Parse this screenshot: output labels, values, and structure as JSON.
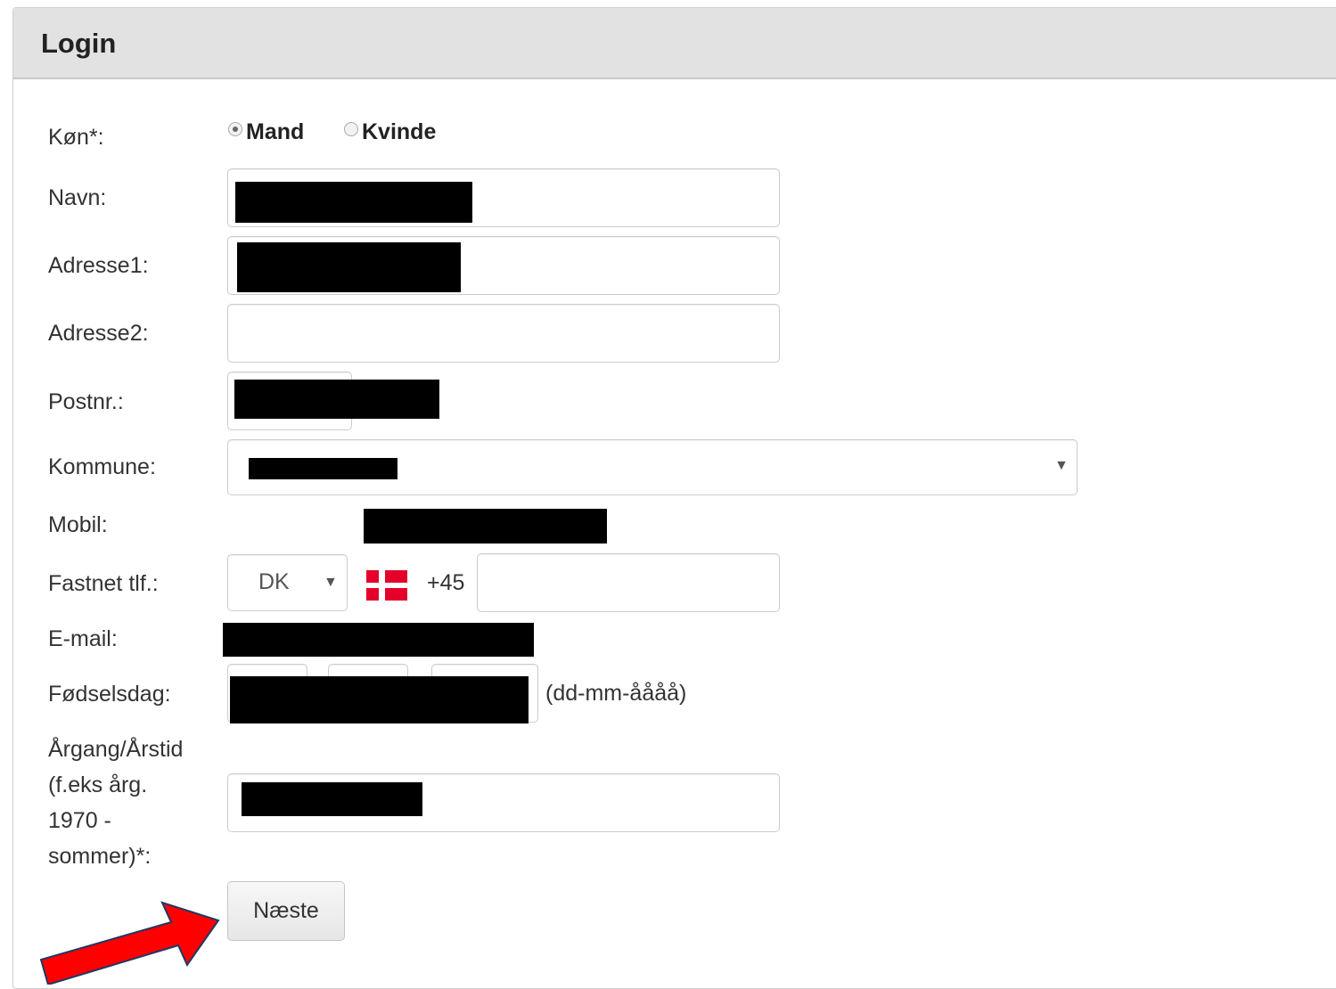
{
  "panel": {
    "title": "Login"
  },
  "form": {
    "gender": {
      "label": "Køn*:",
      "options": [
        {
          "label": "Mand",
          "checked": true
        },
        {
          "label": "Kvinde",
          "checked": false
        }
      ]
    },
    "name": {
      "label": "Navn:"
    },
    "address1": {
      "label": "Adresse1:"
    },
    "address2": {
      "label": "Adresse2:",
      "value": ""
    },
    "postal": {
      "label": "Postnr.:"
    },
    "municipality": {
      "label": "Kommune:"
    },
    "mobile": {
      "label": "Mobil:"
    },
    "landline": {
      "label": "Fastnet tlf.:",
      "country": "DK",
      "prefix": "+45",
      "value": "",
      "flag_colors": {
        "red": "#e4002b",
        "white": "#ffffff"
      }
    },
    "email": {
      "label": "E-mail:"
    },
    "birthday": {
      "label": "Fødselsdag:",
      "format_hint": "(dd-mm-åååå)"
    },
    "class_year": {
      "label_lines": [
        "Årgang/Årstid",
        "(f.eks årg.",
        "1970 -",
        "sommer)*:"
      ]
    },
    "next_button": "Næste"
  },
  "annotation": {
    "arrow_color": "#ff0000"
  }
}
